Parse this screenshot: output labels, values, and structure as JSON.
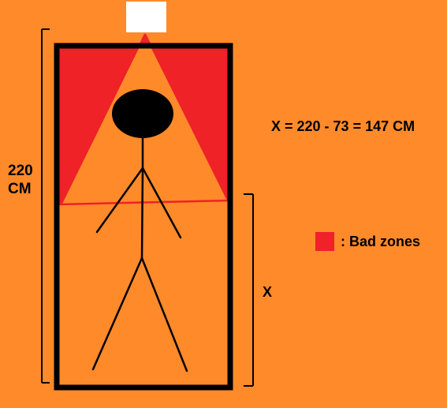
{
  "colors": {
    "background": "#ff8a2a",
    "bad_zone": "#ee2227",
    "outline": "#000000",
    "light": "#ffffff",
    "cone_line": "#ee2227"
  },
  "labels": {
    "height_value": "220",
    "height_unit": "CM",
    "formula": "X = 220 - 73 = 147 CM",
    "x_label": "X"
  },
  "legend": {
    "text": ": Bad zones"
  },
  "icons": {
    "light_source": "ceiling-light-icon",
    "person": "stick-figure-icon"
  }
}
